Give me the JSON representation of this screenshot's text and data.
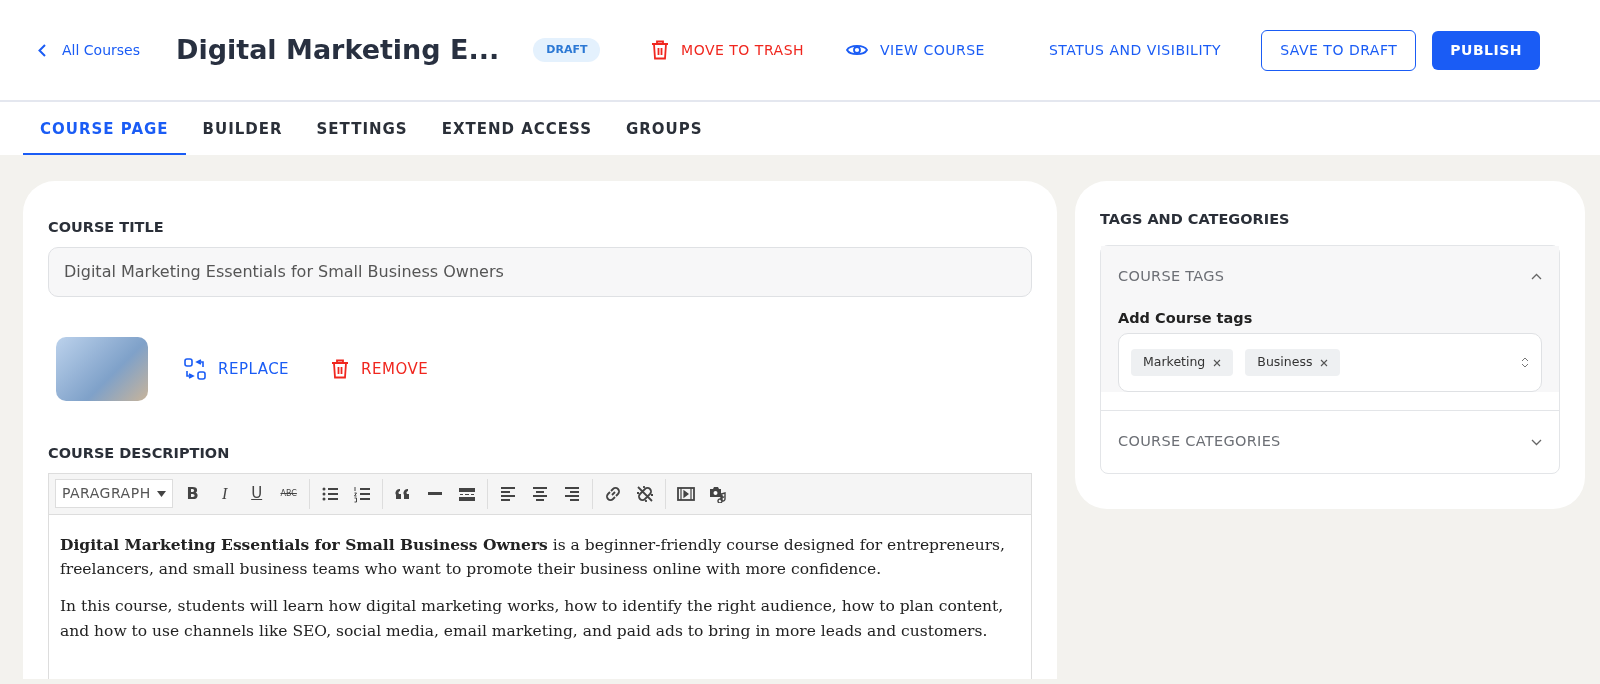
{
  "header": {
    "back_link": "All Courses",
    "title": "Digital Marketing E...",
    "status_badge": "DRAFT",
    "actions": [
      {
        "kind": "trash",
        "label": "MOVE TO TRASH"
      },
      {
        "kind": "view",
        "label": "VIEW COURSE"
      },
      {
        "kind": "link",
        "label": "STATUS AND VISIBILITY"
      },
      {
        "kind": "outline",
        "label": "SAVE TO DRAFT"
      },
      {
        "kind": "primary",
        "label": "PUBLISH"
      }
    ]
  },
  "tabs": [
    {
      "label": "COURSE PAGE",
      "selected": true
    },
    {
      "label": "BUILDER",
      "selected": false
    },
    {
      "label": "SETTINGS",
      "selected": false
    },
    {
      "label": "EXTEND ACCESS",
      "selected": false
    },
    {
      "label": "GROUPS",
      "selected": false
    }
  ],
  "course_title": {
    "label": "COURSE TITLE",
    "value": "Digital Marketing Essentials for Small Business Owners"
  },
  "image_actions": {
    "replace": "REPLACE",
    "remove": "REMOVE"
  },
  "description": {
    "label": "COURSE DESCRIPTION",
    "format_select": "PARAGRAPH",
    "text_buttons": [
      "B",
      "I",
      "U",
      "ABC"
    ],
    "paragraphs": [
      "**Digital Marketing Essentials for Small Business Owners** is a beginner-friendly course designed for entrepreneurs, freelancers, and small business teams who want to promote their business online with more confidence.",
      "In this course, students will learn how digital marketing works, how to identify the right audience, how to plan content, and how to use channels like SEO, social media, email marketing, and paid ads to bring in more leads and customers."
    ]
  },
  "sidebar": {
    "title": "TAGS AND CATEGORIES",
    "sections": [
      {
        "title": "COURSE TAGS",
        "expanded": true,
        "field_label": "Add Course tags",
        "tags": [
          "Marketing",
          "Business"
        ]
      },
      {
        "title": "COURSE CATEGORIES",
        "expanded": false
      }
    ]
  }
}
